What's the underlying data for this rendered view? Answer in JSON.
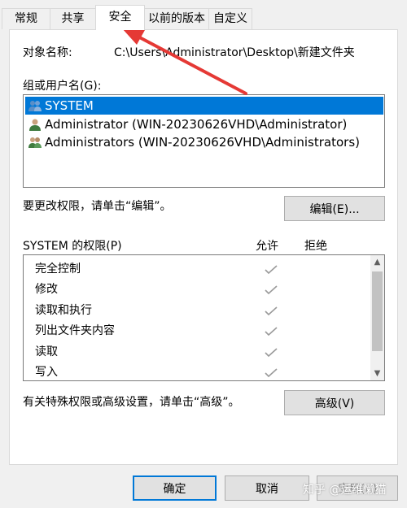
{
  "tabs": [
    {
      "label": "常规"
    },
    {
      "label": "共享"
    },
    {
      "label": "安全"
    },
    {
      "label": "以前的版本"
    },
    {
      "label": "自定义"
    }
  ],
  "object": {
    "label": "对象名称:",
    "value": "C:\\Users\\Administrator\\Desktop\\新建文件夹"
  },
  "groups": {
    "label": "组或用户名(G):",
    "items": [
      {
        "name": "SYSTEM",
        "icon": "group-users-icon"
      },
      {
        "name": "Administrator (WIN-20230626VHD\\Administrator)",
        "icon": "user-icon"
      },
      {
        "name": "Administrators (WIN-20230626VHD\\Administrators)",
        "icon": "group-users-icon"
      }
    ]
  },
  "edit": {
    "hint": "要更改权限，请单击“编辑”。",
    "button": "编辑(E)..."
  },
  "permissions": {
    "title": "SYSTEM 的权限(P)",
    "allow_header": "允许",
    "deny_header": "拒绝",
    "rows": [
      {
        "name": "完全控制",
        "allow": true,
        "deny": false
      },
      {
        "name": "修改",
        "allow": true,
        "deny": false
      },
      {
        "name": "读取和执行",
        "allow": true,
        "deny": false
      },
      {
        "name": "列出文件夹内容",
        "allow": true,
        "deny": false
      },
      {
        "name": "读取",
        "allow": true,
        "deny": false
      },
      {
        "name": "写入",
        "allow": true,
        "deny": false
      }
    ]
  },
  "advanced": {
    "hint": "有关特殊权限或高级设置，请单击“高级”。",
    "button": "高级(V)"
  },
  "footer": {
    "ok": "确定",
    "cancel": "取消",
    "apply": "应用(A)"
  },
  "watermark": "知乎 @运维懒猫",
  "colors": {
    "selection": "#0078d7",
    "arrow": "#e53935"
  }
}
